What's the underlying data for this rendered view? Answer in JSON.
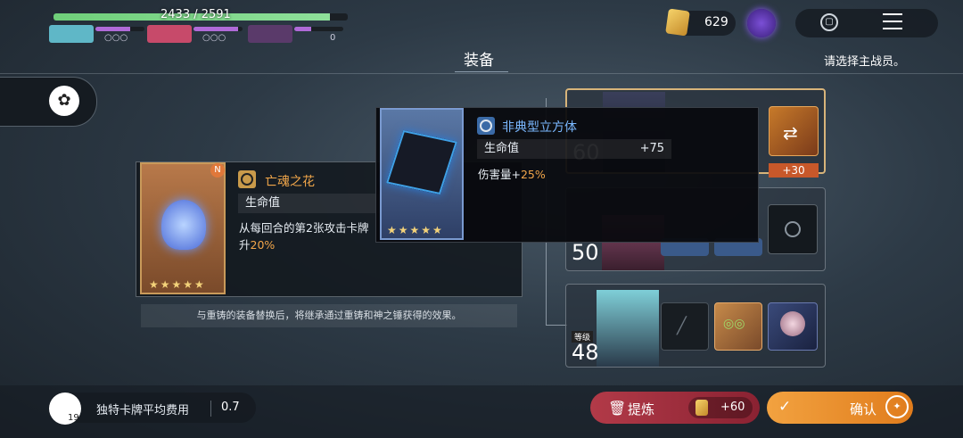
{
  "hud": {
    "hp_text": "2433 / 2591",
    "hp_fraction": 0.94,
    "party": [
      {
        "name": "member-1",
        "color": "#5fb7c7",
        "mana_fraction": 0.7,
        "orbs": "○○○"
      },
      {
        "name": "member-2",
        "color": "#c74a6a",
        "mana_fraction": 0.9,
        "orbs": "○○○"
      },
      {
        "name": "member-3",
        "color": "#5a3a6a",
        "mana_fraction": 0.35,
        "orbs": "0"
      }
    ]
  },
  "currency": {
    "amount": "629"
  },
  "header": {
    "title": "装备",
    "hint": "请选择主战员。"
  },
  "current_item": {
    "rarity_badge": "N",
    "name": "亡魂之花",
    "stat_label": "生命值",
    "effect_prefix": "从每回合的第2张攻击卡牌",
    "effect_suffix_a": "升",
    "effect_highlight": "20%",
    "stars": "★★★★★"
  },
  "reforge_note": "与重铸的装备替换后，将继承通过重铸和神之锤获得的效果。",
  "tooltip_item": {
    "name": "非典型立方体",
    "stat_label": "生命值",
    "stat_value": "+75",
    "effect_prefix": "伤害量+",
    "effect_highlight": "25%",
    "stars": "★★★★★"
  },
  "characters": [
    {
      "level": "60",
      "bonus": "+30"
    },
    {
      "level": "50"
    },
    {
      "level_label": "等级",
      "level": "48"
    }
  ],
  "footer": {
    "card_count": "19",
    "avg_cost_label": "独特卡牌平均费用",
    "avg_cost_value": "0.7",
    "refine_label": "提炼",
    "refine_amount": "+60",
    "confirm_label": "确认"
  }
}
